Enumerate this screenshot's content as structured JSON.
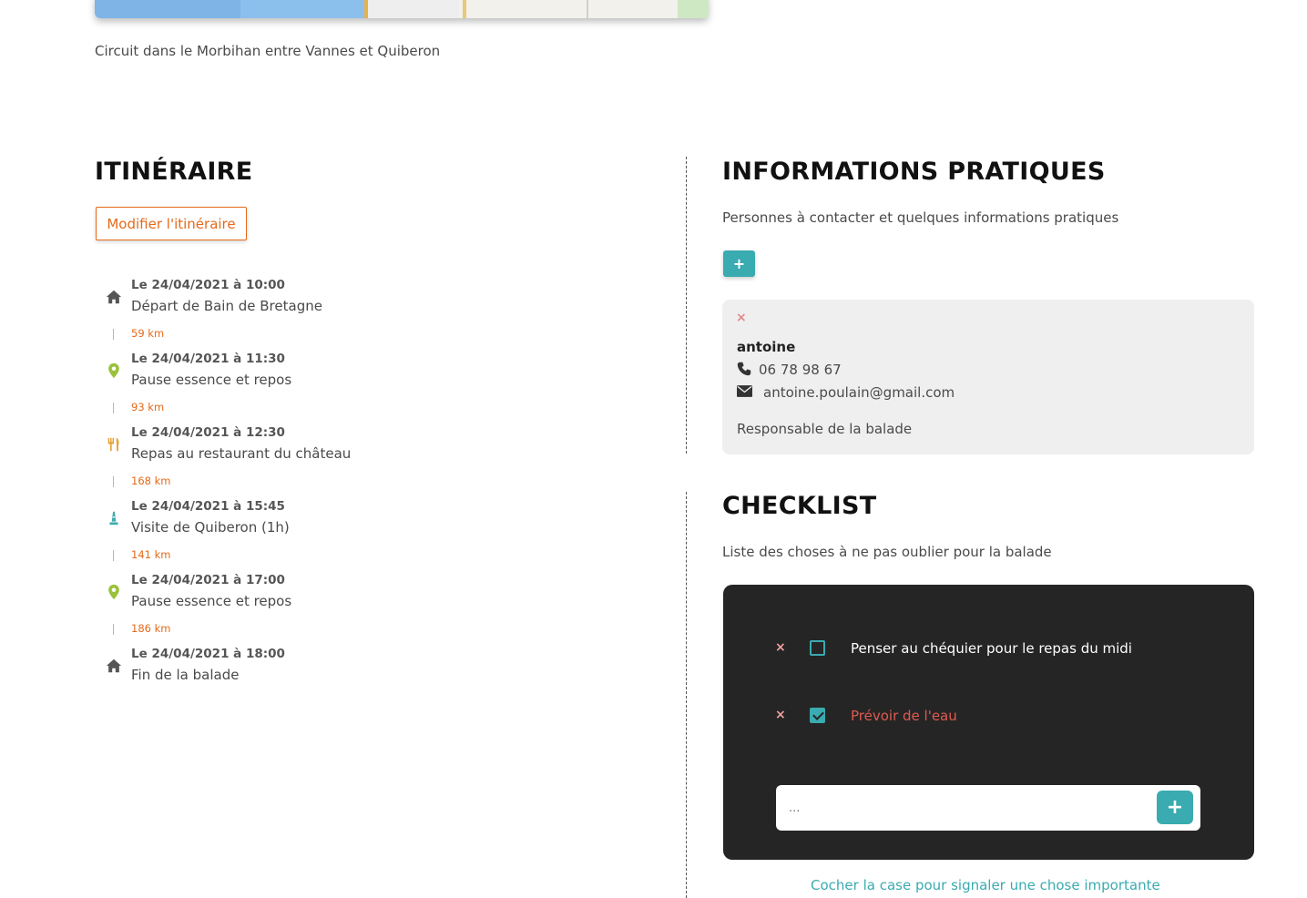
{
  "map": {
    "caption": "Circuit dans le Morbihan entre Vannes et Quiberon"
  },
  "itinerary": {
    "title": "ITINÉRAIRE",
    "modify_label": "Modifier l'itinéraire",
    "steps": [
      {
        "date": "Le 24/04/2021 à 10:00",
        "place": "Départ de Bain de Bretagne",
        "icon": "home-icon",
        "icon_color": "#555555"
      },
      {
        "date": "Le 24/04/2021 à 11:30",
        "place": "Pause essence et repos",
        "icon": "map-pin-icon",
        "icon_color": "#9bc23c"
      },
      {
        "date": "Le 24/04/2021 à 12:30",
        "place": "Repas au restaurant du château",
        "icon": "utensils-icon",
        "icon_color": "#e8a23a"
      },
      {
        "date": "Le 24/04/2021 à 15:45",
        "place": "Visite de Quiberon (1h)",
        "icon": "monument-icon",
        "icon_color": "#3aabb0"
      },
      {
        "date": "Le 24/04/2021 à 17:00",
        "place": "Pause essence et repos",
        "icon": "map-pin-icon",
        "icon_color": "#9bc23c"
      },
      {
        "date": "Le 24/04/2021 à 18:00",
        "place": "Fin de la balade",
        "icon": "home-icon",
        "icon_color": "#555555"
      }
    ],
    "distances": [
      "59 km",
      "93 km",
      "168 km",
      "141 km",
      "186 km"
    ]
  },
  "info": {
    "title": "INFORMATIONS PRATIQUES",
    "subtitle": "Personnes à contacter et quelques informations pratiques",
    "add_label": "+",
    "contact": {
      "delete_label": "×",
      "name": "antoine",
      "phone": "06 78 98 67",
      "email": "antoine.poulain@gmail.com",
      "role": "Responsable de la balade"
    }
  },
  "checklist": {
    "title": "CHECKLIST",
    "subtitle": "Liste des choses à ne pas oublier pour la balade",
    "items": [
      {
        "label": "Penser au chéquier pour le repas du midi",
        "checked": false,
        "delete_label": "×"
      },
      {
        "label": "Prévoir de l'eau",
        "checked": true,
        "delete_label": "×"
      }
    ],
    "new_item_placeholder": "...",
    "add_label": "+",
    "hint": "Cocher la case pour signaler une chose importante"
  },
  "colors": {
    "accent": "#3aabb0",
    "orange": "#e46a1a",
    "important": "#e05a4f",
    "panel": "#252525"
  }
}
